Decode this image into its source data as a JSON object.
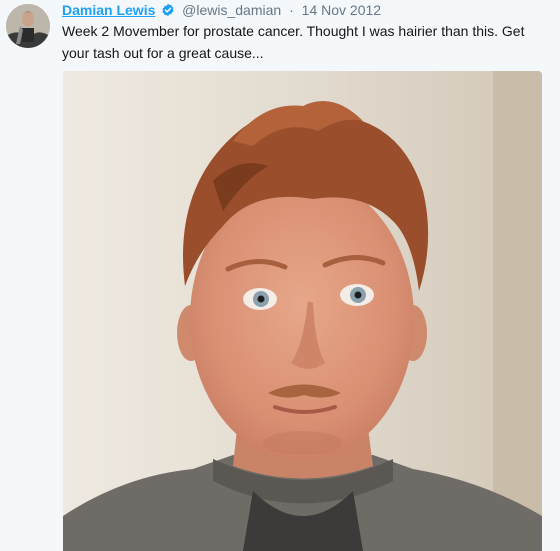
{
  "tweet": {
    "author": {
      "name": "Damian Lewis",
      "handle": "@lewis_damian",
      "verified_icon": "verified-badge-icon",
      "avatar": "profile-photo"
    },
    "separator": "·",
    "date": "14 Nov 2012",
    "text": "Week 2 Movember for prostate cancer. Thought I was hairier than this. Get your tash out for a great cause...",
    "media": {
      "type": "photo",
      "subject": "selfie of man with moustache"
    }
  },
  "colors": {
    "link_blue": "#1da1f2",
    "meta_gray": "#657786",
    "text_dark": "#14171a",
    "background": "#f5f8fa"
  }
}
